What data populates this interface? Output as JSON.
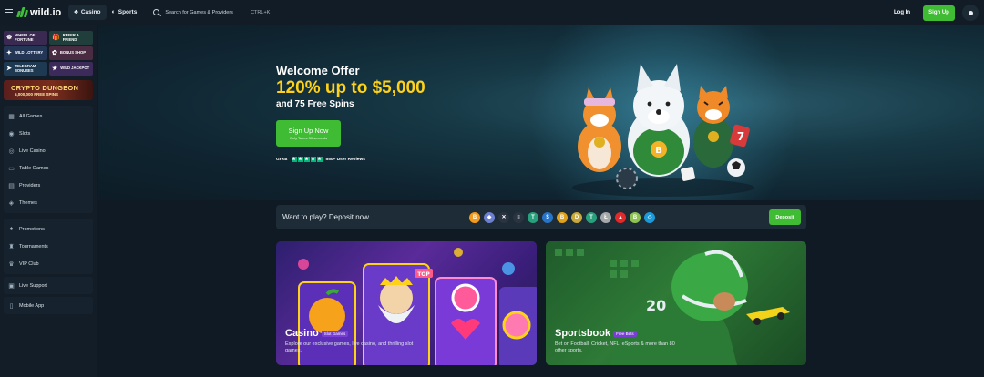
{
  "header": {
    "brand": "wild.io",
    "tabs": [
      {
        "label": "Casino"
      },
      {
        "label": "Sports"
      }
    ],
    "search": {
      "placeholder": "Search for Games & Providers",
      "shortcut": "CTRL+K"
    },
    "login_label": "Log In",
    "signup_label": "Sign Up"
  },
  "sidebar": {
    "promos": [
      {
        "label": "Wheel of Fortune",
        "icon": "wheel-icon"
      },
      {
        "label": "Refer a Friend",
        "icon": "gift-icon"
      },
      {
        "label": "Wild Lottery",
        "icon": "ticket-icon"
      },
      {
        "label": "Bonus Shop",
        "icon": "shop-icon"
      },
      {
        "label": "Telegram Bonuses",
        "icon": "telegram-icon"
      },
      {
        "label": "Wild Jackpot",
        "icon": "jackpot-icon"
      }
    ],
    "banner": {
      "title": "CRYPTO DUNGEON",
      "subtitle": "5,000,000 FREE SPINS"
    },
    "games": [
      {
        "label": "All Games",
        "icon": "grid-icon"
      },
      {
        "label": "Slots",
        "icon": "slot-icon"
      },
      {
        "label": "Live Casino",
        "icon": "live-icon"
      },
      {
        "label": "Table Games",
        "icon": "cards-icon"
      },
      {
        "label": "Providers",
        "icon": "providers-icon"
      },
      {
        "label": "Themes",
        "icon": "themes-icon"
      }
    ],
    "promo_links": [
      {
        "label": "Promotions",
        "icon": "promo-icon"
      },
      {
        "label": "Tournaments",
        "icon": "trophy-icon"
      },
      {
        "label": "VIP Club",
        "icon": "vip-icon"
      }
    ],
    "support": {
      "label": "Live Support",
      "icon": "chat-icon"
    },
    "mobile": {
      "label": "Mobile App",
      "icon": "mobile-icon"
    }
  },
  "hero": {
    "welcome": "Welcome Offer",
    "headline": "120% up to $5,000",
    "sub": "and 75 Free Spins",
    "cta": "Sign Up Now",
    "cta_sub": "Only Takes 30 seconds",
    "rating_label": "Great",
    "reviews": "550+ User Reviews"
  },
  "deposit": {
    "label": "Want to play? Deposit now",
    "button": "Deposit",
    "coins": [
      {
        "name": "bitcoin",
        "symbol": "B",
        "color": "#f29a1b"
      },
      {
        "name": "ethereum",
        "symbol": "◆",
        "color": "#6d7fd1"
      },
      {
        "name": "xrp",
        "symbol": "✕",
        "color": "#2a3440"
      },
      {
        "name": "solana",
        "symbol": "≡",
        "color": "#2a3440"
      },
      {
        "name": "tether",
        "symbol": "T",
        "color": "#26a17b"
      },
      {
        "name": "usdc",
        "symbol": "$",
        "color": "#2775ca"
      },
      {
        "name": "bitcoin-cash",
        "symbol": "B",
        "color": "#e0a21a"
      },
      {
        "name": "dogecoin",
        "symbol": "D",
        "color": "#c9a83c"
      },
      {
        "name": "tether-alt",
        "symbol": "T",
        "color": "#26a17b"
      },
      {
        "name": "litecoin",
        "symbol": "Ł",
        "color": "#a6a9aa"
      },
      {
        "name": "tron",
        "symbol": "▲",
        "color": "#e22a2a"
      },
      {
        "name": "bitcoin-sv",
        "symbol": "B",
        "color": "#8dc351"
      },
      {
        "name": "binance",
        "symbol": "◇",
        "color": "#1a9ad9"
      }
    ]
  },
  "cards": {
    "casino": {
      "title": "Casino",
      "tag": "Slot Games",
      "desc_1": "Explore our exclusive games, live casino, and thrilling slot",
      "desc_2": "games."
    },
    "sports": {
      "title": "Sportsbook",
      "tag": "Free Bets",
      "desc_1": "Bet on Football, Cricket, NFL, eSports & more than 80",
      "desc_2": "other sports."
    }
  },
  "colors": {
    "accent": "#3fbb34",
    "gold": "#ffd21a",
    "bg": "#0f1a24"
  }
}
